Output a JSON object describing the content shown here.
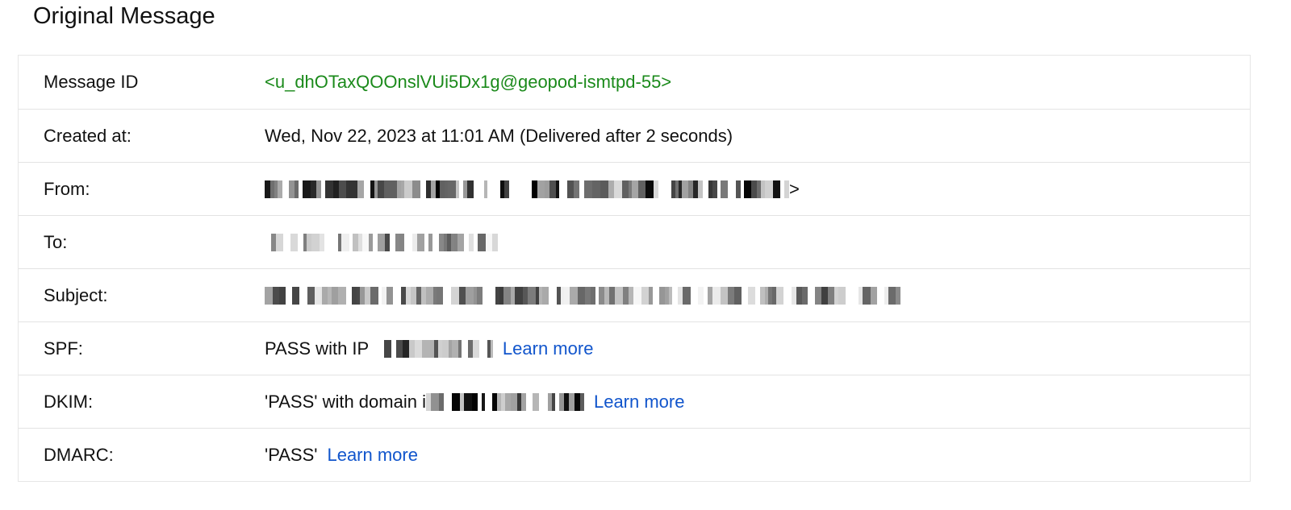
{
  "page_title": "Original Message",
  "rows": [
    {
      "label": "Message ID",
      "value": "<u_dhOTaxQOOnslVUi5Dx1g@geopod-ismtpd-55>"
    },
    {
      "label": "Created at:",
      "value": "Wed, Nov 22, 2023 at 11:01 AM (Delivered after 2 seconds)"
    },
    {
      "label": "From:",
      "value_suffix": ">",
      "redacted": true
    },
    {
      "label": "To:",
      "redacted": true
    },
    {
      "label": "Subject:",
      "redacted": true
    },
    {
      "label": "SPF:",
      "value_prefix": "PASS with IP ",
      "redacted": true,
      "link": "Learn more"
    },
    {
      "label": "DKIM:",
      "value_prefix": "'PASS' with domain i",
      "redacted": true,
      "link": "Learn more"
    },
    {
      "label": "DMARC:",
      "value_prefix": "'PASS'",
      "link": "Learn more"
    }
  ],
  "colors": {
    "message_id": "#1b8a1b",
    "link": "#1155cc",
    "border": "#e3e3e3"
  }
}
